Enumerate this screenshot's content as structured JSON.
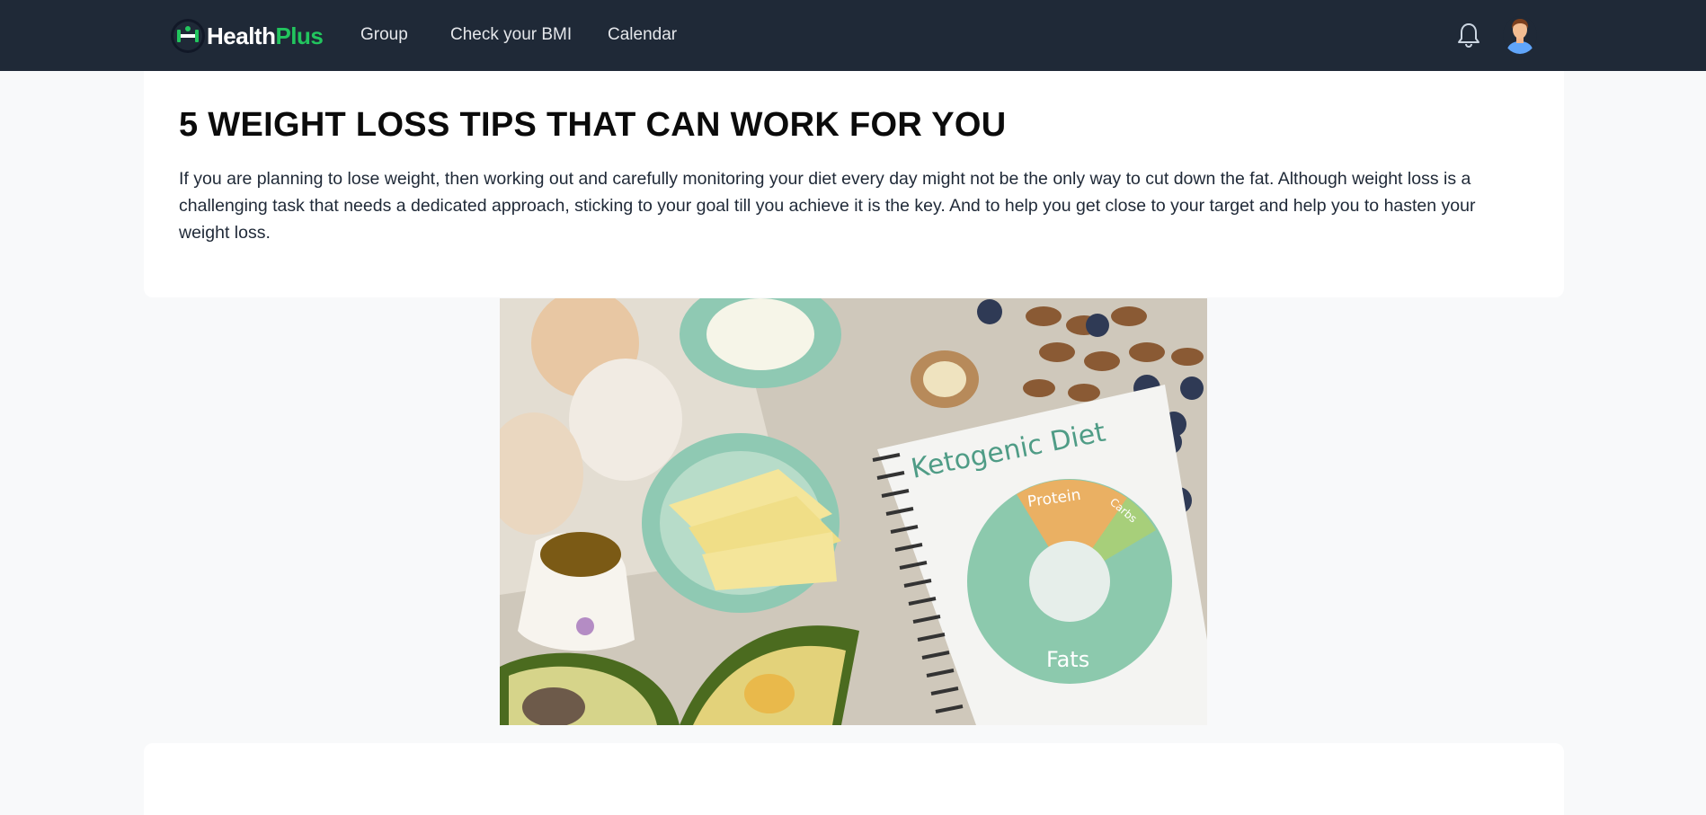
{
  "navbar": {
    "brand": {
      "health": "Health",
      "plus": "Plus"
    },
    "links": [
      {
        "label": "Group"
      },
      {
        "label": "Check your BMI"
      },
      {
        "label": "Calendar"
      }
    ],
    "icons": {
      "notifications": "bell-icon",
      "profile": "user-avatar"
    },
    "colors": {
      "background": "#1f2937",
      "brand_accent": "#22c55e"
    }
  },
  "article": {
    "title": "5 WEIGHT LOSS TIPS THAT CAN WORK FOR YOU",
    "intro": "If you are planning to lose weight, then working out and carefully monitoring your diet every day might not be the only way to cut down the fat. Although weight loss is a challenging task that needs a dedicated approach, sticking to your goal till you achieve it is the key. And to help you get close to your target and help you to hasten your weight loss.",
    "image": {
      "notebook_title": "Ketogenic Diet",
      "segments": [
        "Protein",
        "Carbs",
        "Fats"
      ]
    }
  }
}
